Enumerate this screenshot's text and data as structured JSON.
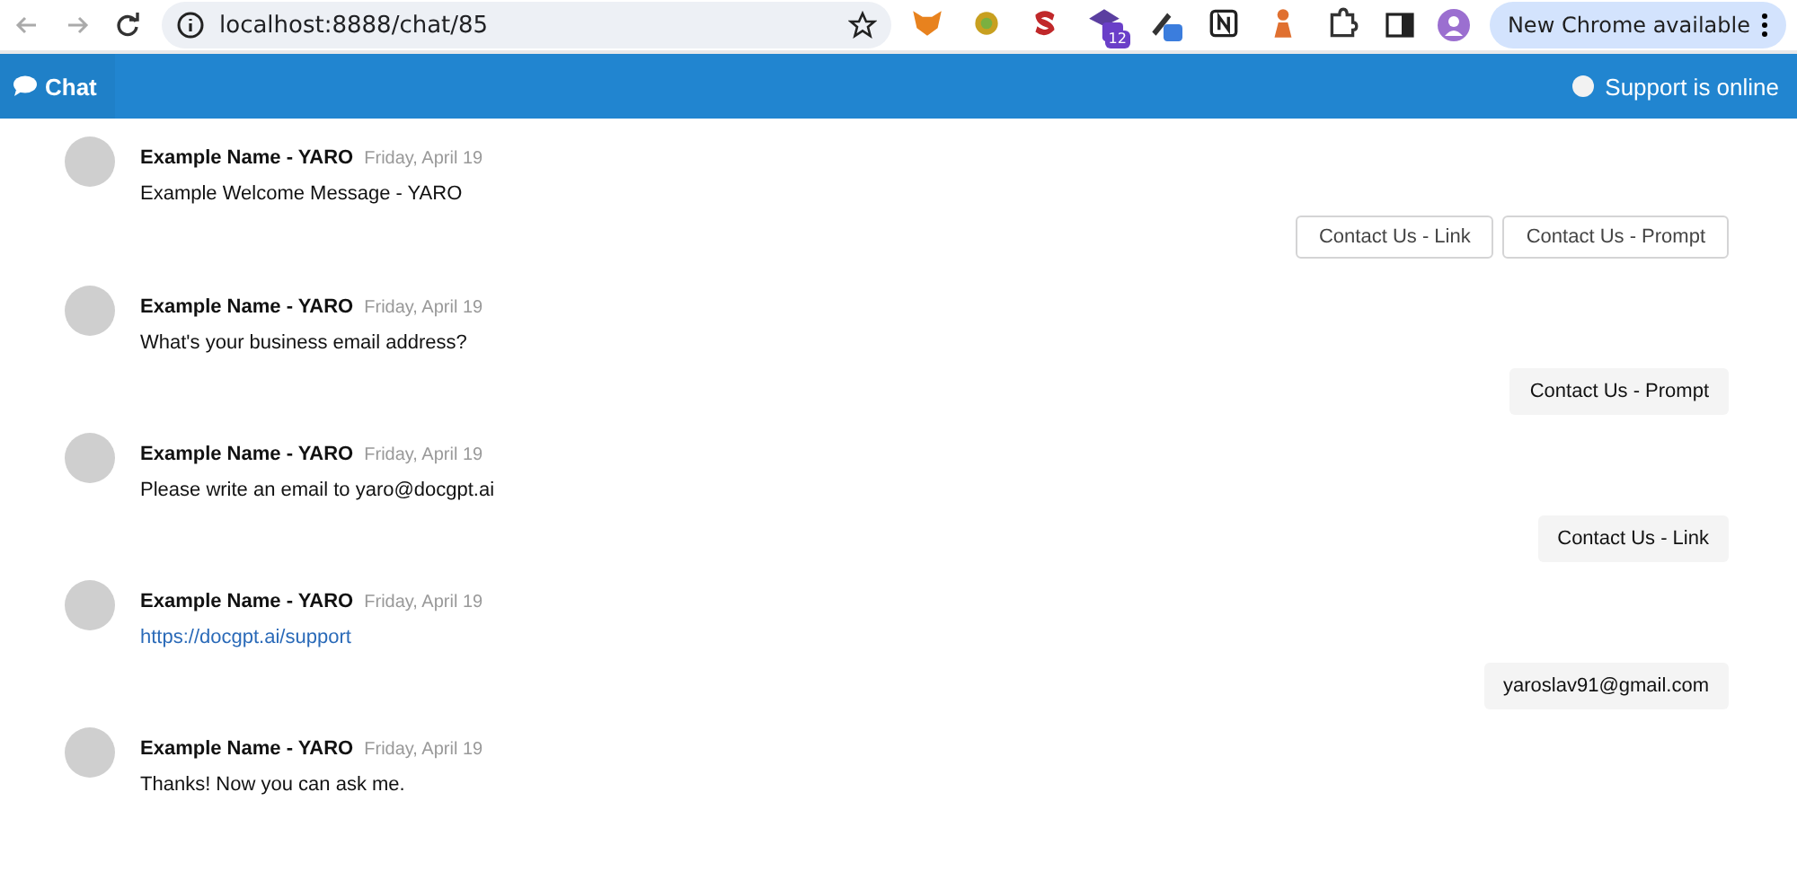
{
  "browser": {
    "url": "localhost:8888/chat/85",
    "extensions": [
      {
        "kind": "fox"
      },
      {
        "kind": "sun"
      },
      {
        "kind": "s"
      },
      {
        "kind": "cap",
        "badge": "12"
      },
      {
        "kind": "pen"
      },
      {
        "kind": "notion"
      },
      {
        "kind": "figure"
      },
      {
        "kind": "puzzle"
      }
    ],
    "update_button": "New Chrome available"
  },
  "header": {
    "title": "Chat",
    "status": "Support is online"
  },
  "feed": [
    {
      "kind": "bot",
      "name": "Example Name - YARO",
      "date": "Friday, April 19",
      "text": "Example Welcome Message - YARO",
      "is_link": false
    },
    {
      "kind": "quick_replies",
      "options": [
        "Contact Us - Link",
        "Contact Us - Prompt"
      ]
    },
    {
      "kind": "bot",
      "name": "Example Name - YARO",
      "date": "Friday, April 19",
      "text": "What's your business email address?",
      "is_link": false
    },
    {
      "kind": "user",
      "text": "Contact Us - Prompt"
    },
    {
      "kind": "bot",
      "name": "Example Name - YARO",
      "date": "Friday, April 19",
      "text": "Please write an email to yaro@docgpt.ai",
      "is_link": false
    },
    {
      "kind": "user",
      "text": "Contact Us - Link"
    },
    {
      "kind": "bot",
      "name": "Example Name - YARO",
      "date": "Friday, April 19",
      "text": "https://docgpt.ai/support",
      "is_link": true
    },
    {
      "kind": "user",
      "text": "yaroslav91@gmail.com"
    },
    {
      "kind": "bot",
      "name": "Example Name - YARO",
      "date": "Friday, April 19",
      "text": "Thanks! Now you can ask me.",
      "is_link": false
    }
  ]
}
